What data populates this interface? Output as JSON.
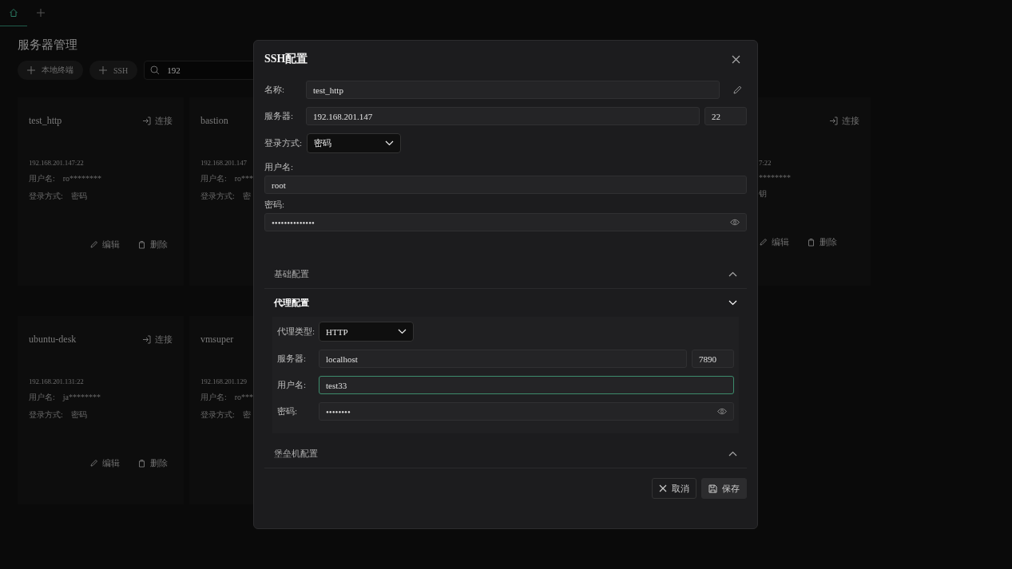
{
  "tabs": [
    {
      "kind": "home",
      "selected": true
    },
    {
      "kind": "add",
      "selected": false
    }
  ],
  "page": {
    "title": "服务器管理",
    "buttons": [
      "本地终端",
      "SSH"
    ],
    "search": {
      "value": "192"
    }
  },
  "card_rows": [
    [
      {
        "kind": "full",
        "name": "test_http",
        "connect": "连接",
        "address": "192.168.201.147:22",
        "user_label": "用户名:",
        "user": "ro********",
        "login_label": "登录方式:",
        "login": "密码",
        "edit": "编辑",
        "delete": "删除"
      },
      {
        "kind": "cut",
        "name": "bastion",
        "address": "192.168.201.147",
        "user_label": "用户名:",
        "user": "ro***",
        "login_label": "登录方式:",
        "login": "密"
      },
      {
        "kind": "right",
        "connect": "连接",
        "address": "7:22",
        "user": "********",
        "login": "钥",
        "edit": "编辑",
        "delete": "删除"
      }
    ],
    [
      {
        "kind": "full",
        "name": "ubuntu-desk",
        "connect": "连接",
        "address": "192.168.201.131:22",
        "user_label": "用户名:",
        "user": "ja********",
        "login_label": "登录方式:",
        "login": "密码",
        "edit": "编辑",
        "delete": "删除"
      },
      {
        "kind": "cut",
        "name": "vmsuper",
        "address": "192.168.201.129",
        "user_label": "用户名:",
        "user": "ro***",
        "login_label": "登录方式:",
        "login": "密"
      }
    ]
  ],
  "dialog": {
    "title": "SSH配置",
    "name": {
      "label": "名称:",
      "value": "test_http"
    },
    "server": {
      "label": "服务器:",
      "host": "192.168.201.147",
      "port": "22"
    },
    "login": {
      "label": "登录方式:",
      "value": "密码"
    },
    "username": {
      "label": "用户名:",
      "value": "root"
    },
    "password": {
      "label": "密码:",
      "value": "••••••••••••••"
    },
    "sections": [
      {
        "title": "基础配置",
        "expanded": false
      },
      {
        "title": "代理配置",
        "expanded": true,
        "proxy": {
          "type": {
            "label": "代理类型:",
            "value": "HTTP"
          },
          "server": {
            "label": "服务器:",
            "host": "localhost",
            "port": "7890"
          },
          "username": {
            "label": "用户名:",
            "value": "test33",
            "focused": true
          },
          "password": {
            "label": "密码:",
            "value": "••••••••"
          }
        }
      },
      {
        "title": "堡垒机配置",
        "expanded": false
      }
    ],
    "buttons": [
      {
        "kind": "cancel",
        "label": "取消"
      },
      {
        "kind": "save",
        "label": "保存"
      }
    ]
  }
}
